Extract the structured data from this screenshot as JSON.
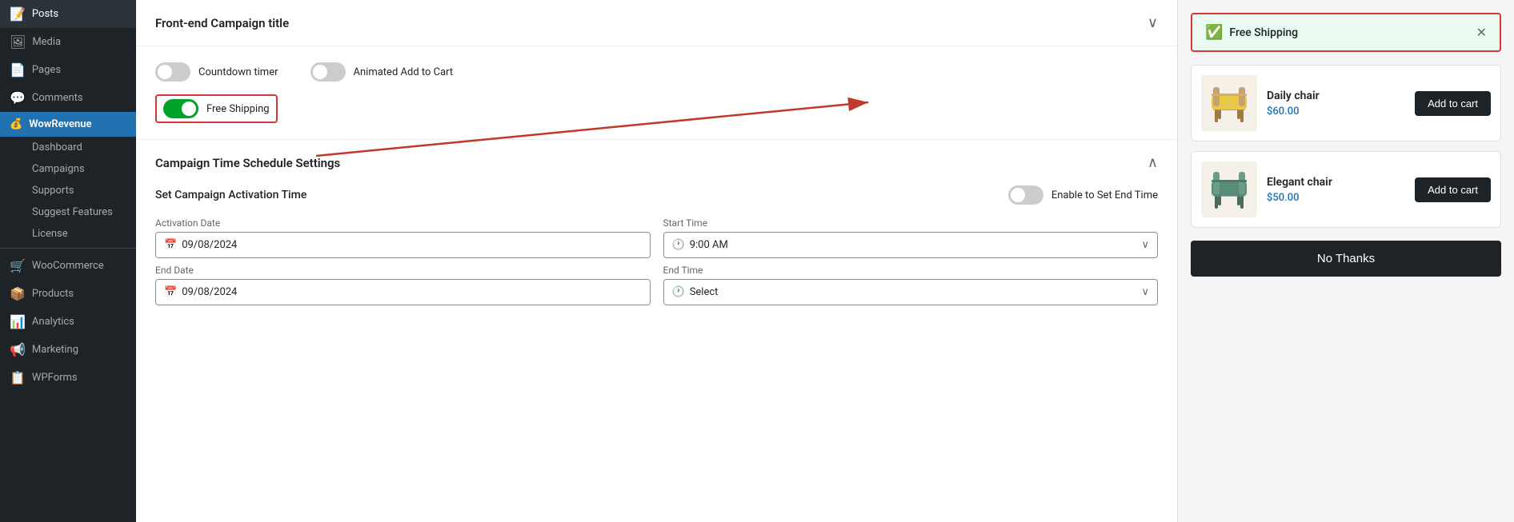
{
  "sidebar": {
    "items": [
      {
        "id": "posts",
        "label": "Posts",
        "icon": "📝",
        "active": false
      },
      {
        "id": "media",
        "label": "Media",
        "icon": "🖼",
        "active": false
      },
      {
        "id": "pages",
        "label": "Pages",
        "icon": "📄",
        "active": false
      },
      {
        "id": "comments",
        "label": "Comments",
        "icon": "💬",
        "active": false
      },
      {
        "id": "wowrevenue",
        "label": "WowRevenue",
        "icon": "💰",
        "active": true
      },
      {
        "id": "dashboard",
        "label": "Dashboard",
        "active": false,
        "sub": true
      },
      {
        "id": "campaigns",
        "label": "Campaigns",
        "active": false,
        "sub": true
      },
      {
        "id": "supports",
        "label": "Supports",
        "active": false,
        "sub": true
      },
      {
        "id": "suggest",
        "label": "Suggest Features",
        "active": false,
        "sub": true
      },
      {
        "id": "license",
        "label": "License",
        "active": false,
        "sub": true
      },
      {
        "id": "woocommerce",
        "label": "WooCommerce",
        "icon": "🛒",
        "active": false
      },
      {
        "id": "products",
        "label": "Products",
        "icon": "📦",
        "active": false
      },
      {
        "id": "analytics",
        "label": "Analytics",
        "icon": "📊",
        "active": false
      },
      {
        "id": "marketing",
        "label": "Marketing",
        "icon": "📢",
        "active": false
      },
      {
        "id": "wpforms",
        "label": "WPForms",
        "icon": "📋",
        "active": false
      }
    ]
  },
  "settings": {
    "frontend_title": "Front-end Campaign title",
    "campaign_time_title": "Campaign Time Schedule Settings",
    "countdown_timer_label": "Countdown timer",
    "animated_add_to_cart_label": "Animated Add to Cart",
    "free_shipping_label": "Free Shipping",
    "free_shipping_enabled": true,
    "countdown_enabled": false,
    "animated_enabled": false,
    "activation_time_label": "Set Campaign Activation Time",
    "enable_end_time_label": "Enable to Set End Time",
    "activation_date_label": "Activation Date",
    "start_time_label": "Start Time",
    "end_date_label": "End Date",
    "end_time_label": "End Time",
    "activation_date_value": "09/08/2024",
    "start_time_value": "9:00 AM",
    "end_date_value": "09/08/2024",
    "end_time_placeholder": "Select"
  },
  "preview": {
    "free_shipping_badge": "Free Shipping",
    "product1": {
      "name": "Daily chair",
      "price": "$60.00",
      "add_to_cart": "Add to cart"
    },
    "product2": {
      "name": "Elegant chair",
      "price": "$50.00",
      "add_to_cart": "Add to cart"
    },
    "no_thanks": "No Thanks"
  }
}
